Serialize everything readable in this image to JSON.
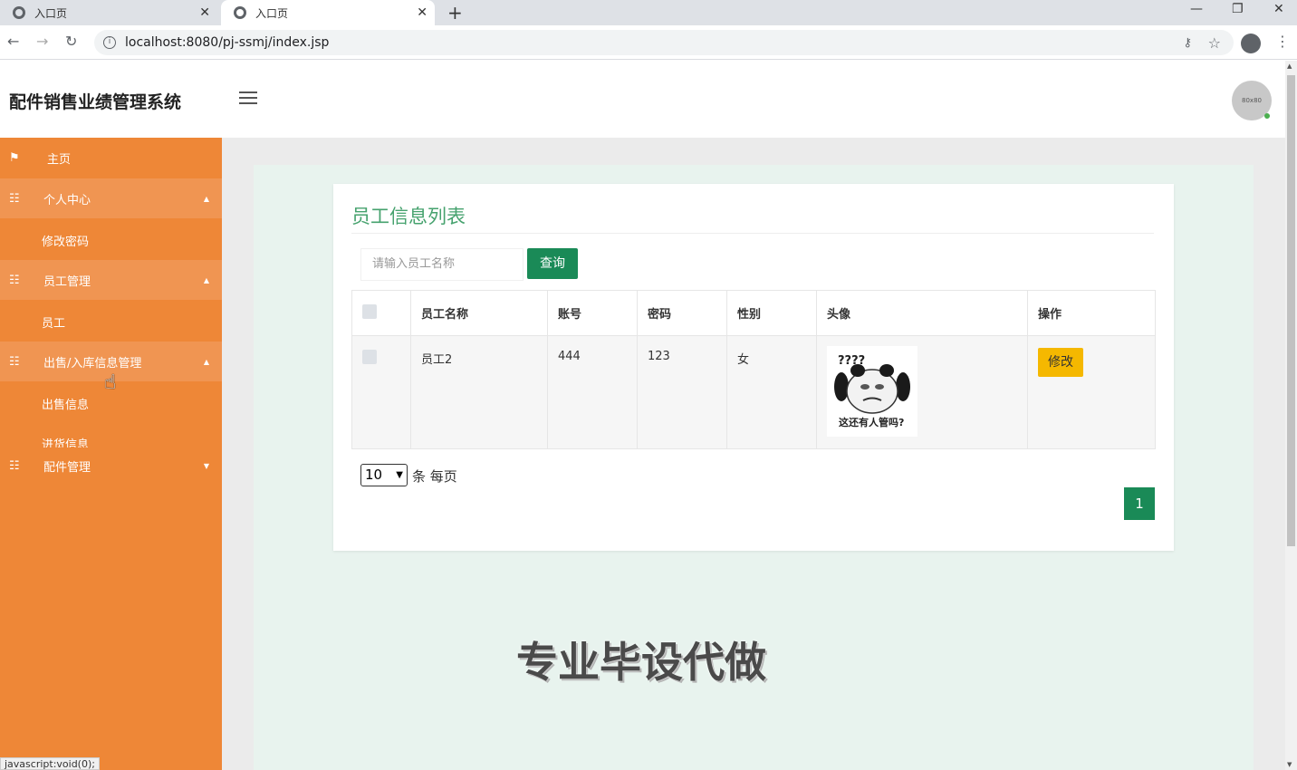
{
  "browser": {
    "tabs": [
      {
        "title": "入口页",
        "active": false
      },
      {
        "title": "入口页",
        "active": true
      }
    ],
    "url": "localhost:8080/pj-ssmj/index.jsp",
    "status_text": "javascript:void(0);"
  },
  "header": {
    "brand": "配件销售业绩管理系统",
    "avatar_text": "80x80"
  },
  "sidebar": {
    "home": "主页",
    "groups": [
      {
        "label": "个人中心",
        "children": [
          "修改密码"
        ]
      },
      {
        "label": "员工管理",
        "children": [
          "员工"
        ]
      },
      {
        "label": "出售/入库信息管理",
        "children": [
          "出售信息",
          "进货信息"
        ]
      },
      {
        "label": "配件管理",
        "children": []
      }
    ]
  },
  "main": {
    "title": "员工信息列表",
    "search_placeholder": "请输入员工名称",
    "search_button": "查询",
    "columns": [
      "员工名称",
      "账号",
      "密码",
      "性别",
      "头像",
      "操作"
    ],
    "rows": [
      {
        "name": "员工2",
        "account": "444",
        "password": "123",
        "gender": "女",
        "edit": "修改"
      }
    ],
    "meme_text": "这还有人管吗?",
    "meme_marks": "????",
    "page_size": "10",
    "per_page_text": "条 每页",
    "current_page": "1"
  },
  "watermark": "专业毕设代做",
  "colors": {
    "sidebar": "#ee8737",
    "accent_green": "#1a8a57",
    "title_green": "#46a26e",
    "edit_button": "#f5b800"
  }
}
